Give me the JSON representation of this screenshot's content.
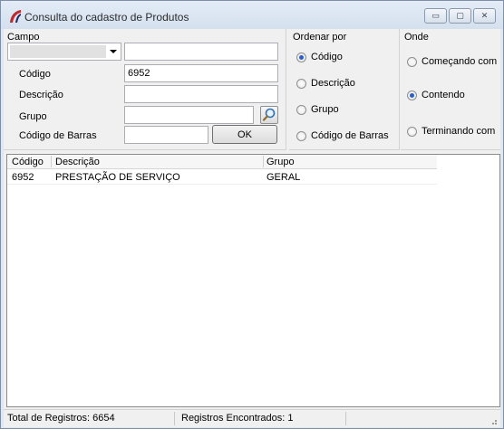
{
  "window": {
    "title": "Consulta do cadastro de Produtos",
    "minimize_glyph": "▭",
    "maximize_glyph": "▢",
    "close_glyph": "✕"
  },
  "campo": {
    "title": "Campo",
    "combo_value": "",
    "combo_text": "",
    "codigo_label": "Código",
    "codigo_value": "6952",
    "descricao_label": "Descrição",
    "descricao_value": "",
    "grupo_label": "Grupo",
    "grupo_value": "",
    "codigo_barras_label": "Código de Barras",
    "codigo_barras_value": "",
    "ok_label": "OK"
  },
  "ordenar": {
    "title": "Ordenar por",
    "options": [
      "Código",
      "Descrição",
      "Grupo",
      "Código de Barras"
    ],
    "selected": "Código"
  },
  "onde": {
    "title": "Onde",
    "options": [
      "Começando com",
      "Contendo",
      "Terminando com"
    ],
    "selected": "Contendo"
  },
  "grid": {
    "columns": [
      "Código",
      "Descrição",
      "Grupo"
    ],
    "rows": [
      [
        "6952",
        "PRESTAÇÃO DE SERVIÇO",
        "GERAL"
      ]
    ]
  },
  "status": {
    "total": "Total de Registros: 6654",
    "found": "Registros Encontrados: 1"
  },
  "colors": {
    "radio_selected": "#2c5fc2",
    "title_bar": "#d9e4f1"
  }
}
